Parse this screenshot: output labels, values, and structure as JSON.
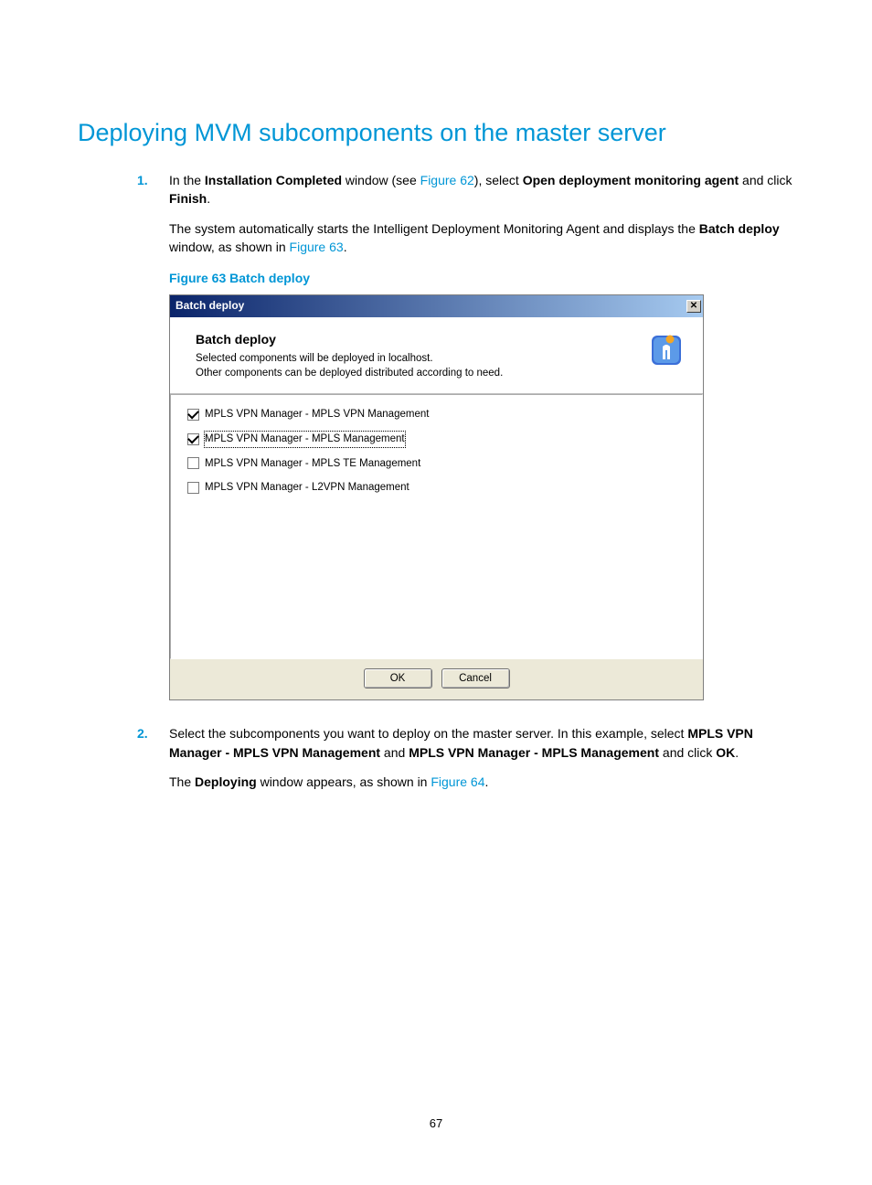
{
  "heading": "Deploying MVM subcomponents on the master server",
  "steps": {
    "s1": {
      "num": "1.",
      "p1_a": "In the ",
      "p1_b": "Installation Completed",
      "p1_c": " window (see ",
      "p1_link": "Figure 62",
      "p1_d": "), select ",
      "p1_e": "Open deployment monitoring agent",
      "p1_f": " and click ",
      "p1_g": "Finish",
      "p1_h": ".",
      "p2_a": "The system automatically starts the Intelligent Deployment Monitoring Agent and displays the ",
      "p2_b": "Batch deploy",
      "p2_c": " window, as shown in ",
      "p2_link": "Figure 63",
      "p2_d": "."
    },
    "s2": {
      "num": "2.",
      "p1_a": "Select the subcomponents you want to deploy on the master server. In this example, select ",
      "p1_b": "MPLS VPN Manager - MPLS VPN Management",
      "p1_c": " and ",
      "p1_d": "MPLS VPN Manager - MPLS Management",
      "p1_e": " and click ",
      "p1_f": "OK",
      "p1_g": ".",
      "p2_a": "The ",
      "p2_b": "Deploying",
      "p2_c": " window appears, as shown in ",
      "p2_link": "Figure 64",
      "p2_d": "."
    }
  },
  "figure_caption": "Figure 63 Batch deploy",
  "dialog": {
    "title": "Batch deploy",
    "header_title": "Batch deploy",
    "header_line1": "Selected components will be deployed in localhost.",
    "header_line2": "Other components can be deployed distributed according to need.",
    "items": [
      {
        "label": "MPLS VPN Manager - MPLS VPN Management",
        "checked": true,
        "focused": false
      },
      {
        "label": "MPLS VPN Manager - MPLS Management",
        "checked": true,
        "focused": true
      },
      {
        "label": "MPLS VPN Manager - MPLS TE Management",
        "checked": false,
        "focused": false
      },
      {
        "label": "MPLS VPN Manager - L2VPN Management",
        "checked": false,
        "focused": false
      }
    ],
    "ok": "OK",
    "cancel": "Cancel"
  },
  "page_number": "67"
}
